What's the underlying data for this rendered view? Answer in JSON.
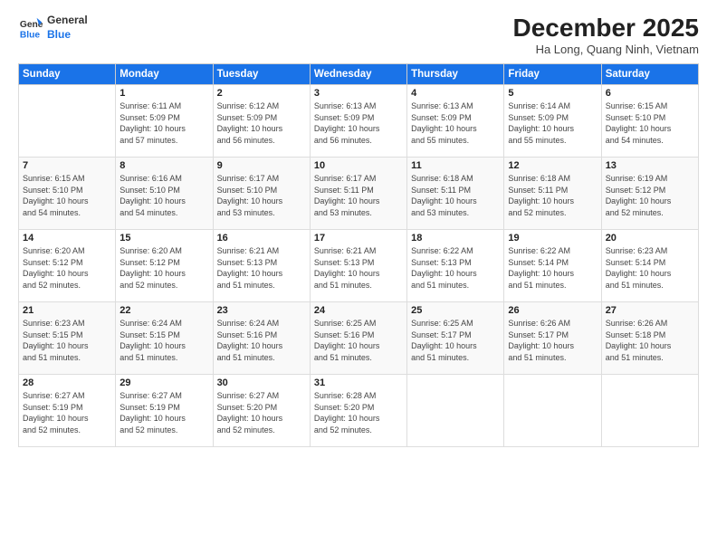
{
  "logo": {
    "line1": "General",
    "line2": "Blue"
  },
  "title": "December 2025",
  "location": "Ha Long, Quang Ninh, Vietnam",
  "weekdays": [
    "Sunday",
    "Monday",
    "Tuesday",
    "Wednesday",
    "Thursday",
    "Friday",
    "Saturday"
  ],
  "weeks": [
    [
      {
        "day": "",
        "info": ""
      },
      {
        "day": "1",
        "info": "Sunrise: 6:11 AM\nSunset: 5:09 PM\nDaylight: 10 hours\nand 57 minutes."
      },
      {
        "day": "2",
        "info": "Sunrise: 6:12 AM\nSunset: 5:09 PM\nDaylight: 10 hours\nand 56 minutes."
      },
      {
        "day": "3",
        "info": "Sunrise: 6:13 AM\nSunset: 5:09 PM\nDaylight: 10 hours\nand 56 minutes."
      },
      {
        "day": "4",
        "info": "Sunrise: 6:13 AM\nSunset: 5:09 PM\nDaylight: 10 hours\nand 55 minutes."
      },
      {
        "day": "5",
        "info": "Sunrise: 6:14 AM\nSunset: 5:09 PM\nDaylight: 10 hours\nand 55 minutes."
      },
      {
        "day": "6",
        "info": "Sunrise: 6:15 AM\nSunset: 5:10 PM\nDaylight: 10 hours\nand 54 minutes."
      }
    ],
    [
      {
        "day": "7",
        "info": "Sunrise: 6:15 AM\nSunset: 5:10 PM\nDaylight: 10 hours\nand 54 minutes."
      },
      {
        "day": "8",
        "info": "Sunrise: 6:16 AM\nSunset: 5:10 PM\nDaylight: 10 hours\nand 54 minutes."
      },
      {
        "day": "9",
        "info": "Sunrise: 6:17 AM\nSunset: 5:10 PM\nDaylight: 10 hours\nand 53 minutes."
      },
      {
        "day": "10",
        "info": "Sunrise: 6:17 AM\nSunset: 5:11 PM\nDaylight: 10 hours\nand 53 minutes."
      },
      {
        "day": "11",
        "info": "Sunrise: 6:18 AM\nSunset: 5:11 PM\nDaylight: 10 hours\nand 53 minutes."
      },
      {
        "day": "12",
        "info": "Sunrise: 6:18 AM\nSunset: 5:11 PM\nDaylight: 10 hours\nand 52 minutes."
      },
      {
        "day": "13",
        "info": "Sunrise: 6:19 AM\nSunset: 5:12 PM\nDaylight: 10 hours\nand 52 minutes."
      }
    ],
    [
      {
        "day": "14",
        "info": "Sunrise: 6:20 AM\nSunset: 5:12 PM\nDaylight: 10 hours\nand 52 minutes."
      },
      {
        "day": "15",
        "info": "Sunrise: 6:20 AM\nSunset: 5:12 PM\nDaylight: 10 hours\nand 52 minutes."
      },
      {
        "day": "16",
        "info": "Sunrise: 6:21 AM\nSunset: 5:13 PM\nDaylight: 10 hours\nand 51 minutes."
      },
      {
        "day": "17",
        "info": "Sunrise: 6:21 AM\nSunset: 5:13 PM\nDaylight: 10 hours\nand 51 minutes."
      },
      {
        "day": "18",
        "info": "Sunrise: 6:22 AM\nSunset: 5:13 PM\nDaylight: 10 hours\nand 51 minutes."
      },
      {
        "day": "19",
        "info": "Sunrise: 6:22 AM\nSunset: 5:14 PM\nDaylight: 10 hours\nand 51 minutes."
      },
      {
        "day": "20",
        "info": "Sunrise: 6:23 AM\nSunset: 5:14 PM\nDaylight: 10 hours\nand 51 minutes."
      }
    ],
    [
      {
        "day": "21",
        "info": "Sunrise: 6:23 AM\nSunset: 5:15 PM\nDaylight: 10 hours\nand 51 minutes."
      },
      {
        "day": "22",
        "info": "Sunrise: 6:24 AM\nSunset: 5:15 PM\nDaylight: 10 hours\nand 51 minutes."
      },
      {
        "day": "23",
        "info": "Sunrise: 6:24 AM\nSunset: 5:16 PM\nDaylight: 10 hours\nand 51 minutes."
      },
      {
        "day": "24",
        "info": "Sunrise: 6:25 AM\nSunset: 5:16 PM\nDaylight: 10 hours\nand 51 minutes."
      },
      {
        "day": "25",
        "info": "Sunrise: 6:25 AM\nSunset: 5:17 PM\nDaylight: 10 hours\nand 51 minutes."
      },
      {
        "day": "26",
        "info": "Sunrise: 6:26 AM\nSunset: 5:17 PM\nDaylight: 10 hours\nand 51 minutes."
      },
      {
        "day": "27",
        "info": "Sunrise: 6:26 AM\nSunset: 5:18 PM\nDaylight: 10 hours\nand 51 minutes."
      }
    ],
    [
      {
        "day": "28",
        "info": "Sunrise: 6:27 AM\nSunset: 5:19 PM\nDaylight: 10 hours\nand 52 minutes."
      },
      {
        "day": "29",
        "info": "Sunrise: 6:27 AM\nSunset: 5:19 PM\nDaylight: 10 hours\nand 52 minutes."
      },
      {
        "day": "30",
        "info": "Sunrise: 6:27 AM\nSunset: 5:20 PM\nDaylight: 10 hours\nand 52 minutes."
      },
      {
        "day": "31",
        "info": "Sunrise: 6:28 AM\nSunset: 5:20 PM\nDaylight: 10 hours\nand 52 minutes."
      },
      {
        "day": "",
        "info": ""
      },
      {
        "day": "",
        "info": ""
      },
      {
        "day": "",
        "info": ""
      }
    ]
  ]
}
